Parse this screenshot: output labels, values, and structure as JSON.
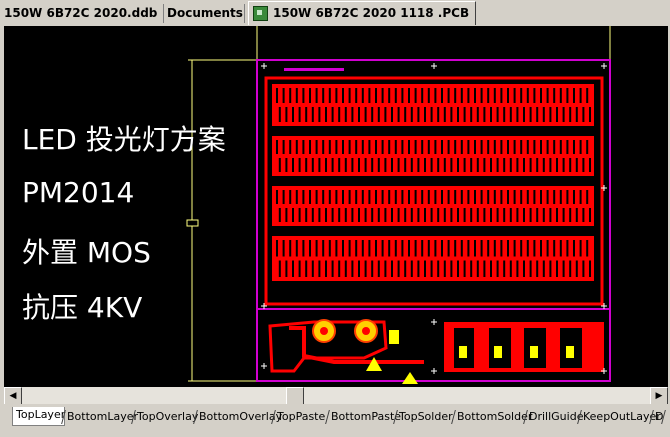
{
  "doc_tabs": [
    {
      "label": "150W 6B72C 2020.ddb"
    },
    {
      "label": "Documents"
    },
    {
      "label": "150W 6B72C 2020 1118 .PCB",
      "active": true
    }
  ],
  "overlay_lines": [
    "LED 投光灯方案",
    "PM2014",
    "外置 MOS",
    "抗压 4KV"
  ],
  "layer_tabs": [
    "TopLayer",
    "BottomLayer",
    "TopOverlay",
    "BottomOverlay",
    "TopPaste",
    "BottomPaste",
    "TopSolder",
    "BottomSolder",
    "DrillGuide",
    "KeepOutLayer",
    "D"
  ],
  "scroll": {
    "left_arrow": "◀",
    "right_arrow": "▶"
  },
  "colors": {
    "board_outline": "#d000d0",
    "copper": "#ff0000",
    "pad": "#ffff00",
    "selection_line": "#ffff80",
    "background": "#000000"
  }
}
